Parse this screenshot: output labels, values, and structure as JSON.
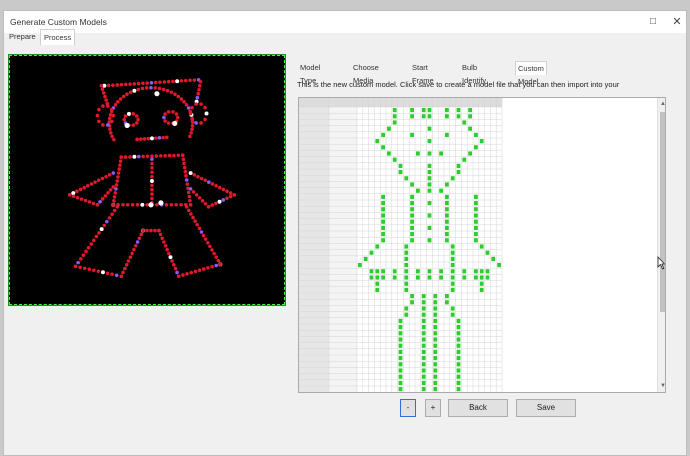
{
  "window": {
    "title": "Generate Custom Models",
    "maximize_glyph": "□",
    "close_glyph": "✕"
  },
  "top_tabs": [
    {
      "label": "Prepare",
      "active": false
    },
    {
      "label": "Process",
      "active": true
    }
  ],
  "sub_tabs": [
    {
      "label": "Model Type",
      "active": false
    },
    {
      "label": "Choose Media",
      "active": false
    },
    {
      "label": "Start Frame",
      "active": false
    },
    {
      "label": "Bulb Identify",
      "active": false
    },
    {
      "label": "Custom Model",
      "active": true
    }
  ],
  "description": "This is the new custom model. Click save to create a model file that you can then import into your",
  "buttons": {
    "minus": "-",
    "plus": "+",
    "back": "Back",
    "save": "Save"
  },
  "scroll": {
    "up_glyph": "▲",
    "down_glyph": "▼"
  },
  "colors": {
    "accent_blue": "#2f6fd6",
    "bulb_green": "#2ecc2e",
    "preview_border": "#3aff3a",
    "light_red": "#e0192b",
    "light_white": "#ffffff",
    "light_purple": "#8a5cff"
  },
  "icons": {
    "maximize": "maximize-icon",
    "close": "close-icon",
    "scroll_up": "scroll-up-icon",
    "scroll_down": "scroll-down-icon",
    "cursor": "mouse-cursor-icon"
  }
}
